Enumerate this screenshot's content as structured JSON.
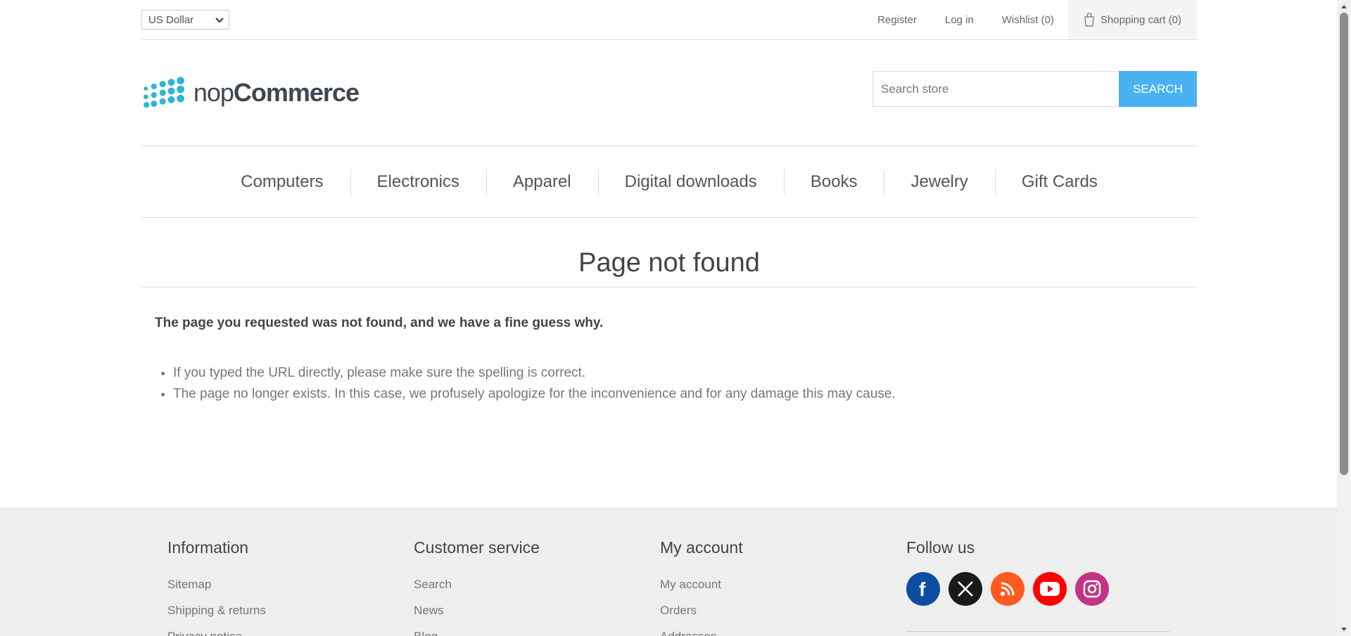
{
  "header": {
    "currency": "US Dollar",
    "links": [
      "Register",
      "Log in",
      "Wishlist (0)"
    ],
    "cart": "Shopping cart (0)"
  },
  "logo": {
    "text_light": "nop",
    "text_bold": "Commerce",
    "color": "#2db5d6"
  },
  "search": {
    "placeholder": "Search store",
    "button": "SEARCH",
    "button_color": "#4ab2f1"
  },
  "nav": [
    "Computers",
    "Electronics",
    "Apparel",
    "Digital downloads",
    "Books",
    "Jewelry",
    "Gift Cards"
  ],
  "main": {
    "title": "Page not found",
    "lead": "The page you requested was not found, and we have a fine guess why.",
    "reasons": [
      "If you typed the URL directly, please make sure the spelling is correct.",
      "The page no longer exists. In this case, we profusely apologize for the inconvenience and for any damage this may cause."
    ]
  },
  "footer": {
    "information": {
      "title": "Information",
      "links": [
        "Sitemap",
        "Shipping & returns",
        "Privacy notice"
      ]
    },
    "customer_service": {
      "title": "Customer service",
      "links": [
        "Search",
        "News",
        "Blog"
      ]
    },
    "my_account": {
      "title": "My account",
      "links": [
        "My account",
        "Orders",
        "Addresses"
      ]
    },
    "follow_us": {
      "title": "Follow us",
      "icons": [
        {
          "name": "facebook-icon",
          "color": "#0c4da2"
        },
        {
          "name": "x-icon",
          "color": "#1a1a1a"
        },
        {
          "name": "rss-icon",
          "color": "#ff5a1f"
        },
        {
          "name": "youtube-icon",
          "color": "#ff0000"
        },
        {
          "name": "instagram-icon",
          "color": "#c13584"
        }
      ]
    }
  }
}
